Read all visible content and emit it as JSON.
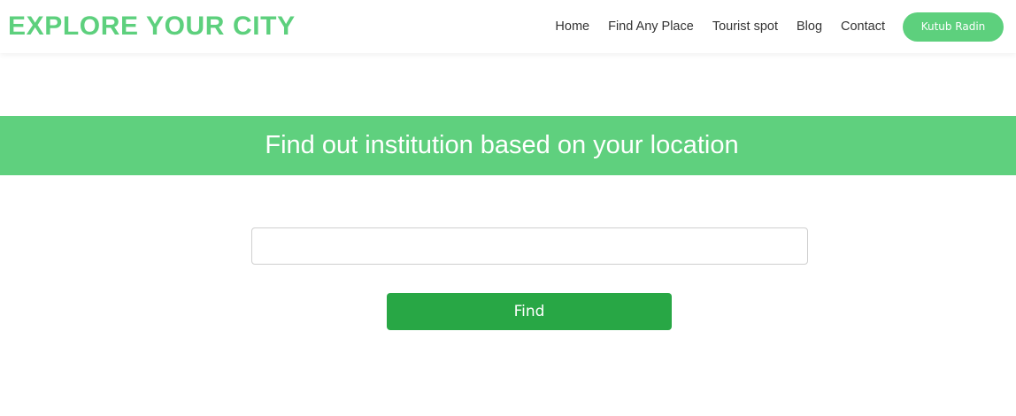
{
  "header": {
    "brand": "EXPLORE YOUR CITY",
    "nav": [
      {
        "label": "Home"
      },
      {
        "label": "Find Any Place"
      },
      {
        "label": "Tourist spot"
      },
      {
        "label": "Blog"
      },
      {
        "label": "Contact"
      }
    ],
    "user_button": "Kutub Radin"
  },
  "banner": {
    "title": "Find out institution based on your location"
  },
  "search": {
    "value": "",
    "placeholder": "",
    "button": "Find"
  },
  "colors": {
    "brand": "#5dd07d",
    "banner": "#5fd07e",
    "find_button": "#28a745",
    "text": "#333333"
  }
}
